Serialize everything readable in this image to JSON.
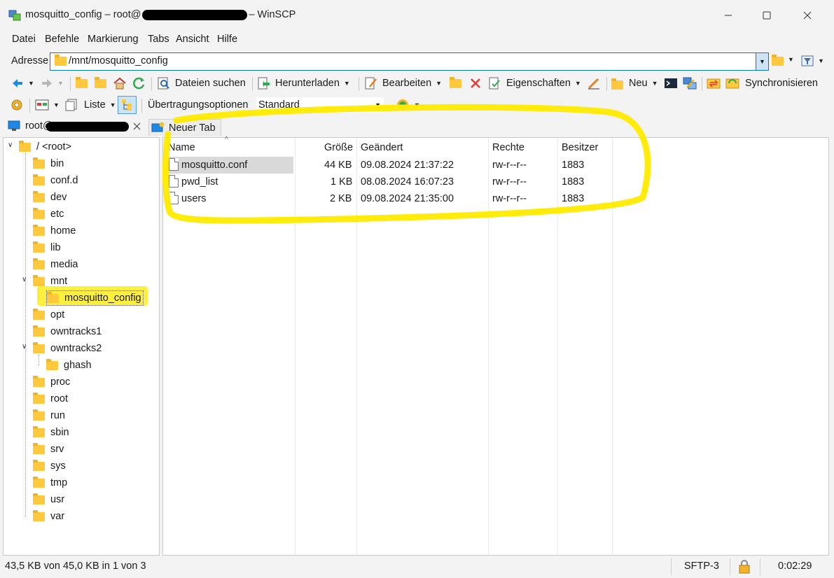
{
  "window": {
    "title": "mosquitto_config – root@",
    "title_suffix": "– WinSCP",
    "buttons": [
      "minimize",
      "maximize",
      "close"
    ]
  },
  "menu": [
    "Datei",
    "Befehle",
    "Markierung",
    "Tabs",
    "Ansicht",
    "Hilfe"
  ],
  "address": {
    "label": "Adresse",
    "value": "/mnt/mosquitto_config"
  },
  "toolbar1": {
    "find_files": "Dateien suchen",
    "download": "Herunterladen",
    "edit": "Bearbeiten",
    "properties": "Eigenschaften",
    "new": "Neu",
    "synchronize": "Synchronisieren"
  },
  "toolbar2": {
    "view": "Liste",
    "transfer_options_label": "Übertragungsoptionen",
    "transfer_options_value": "Standard"
  },
  "tabs": {
    "session": "root@",
    "new_tab": "Neuer Tab"
  },
  "tree": {
    "root": "/ <root>",
    "items": [
      "bin",
      "conf.d",
      "dev",
      "etc",
      "home",
      "lib",
      "media",
      "mnt",
      "mosquitto_config",
      "opt",
      "owntracks1",
      "owntracks2",
      "ghash",
      "proc",
      "root",
      "run",
      "sbin",
      "srv",
      "sys",
      "tmp",
      "usr",
      "var"
    ]
  },
  "files": {
    "columns": [
      "Name",
      "Größe",
      "Geändert",
      "Rechte",
      "Besitzer"
    ],
    "rows": [
      {
        "name": "mosquitto.conf",
        "size": "44 KB",
        "modified": "09.08.2024 21:37:22",
        "rights": "rw-r--r--",
        "owner": "1883"
      },
      {
        "name": "pwd_list",
        "size": "1 KB",
        "modified": "08.08.2024 16:07:23",
        "rights": "rw-r--r--",
        "owner": "1883"
      },
      {
        "name": "users",
        "size": "2 KB",
        "modified": "09.08.2024 21:35:00",
        "rights": "rw-r--r--",
        "owner": "1883"
      }
    ]
  },
  "status": {
    "selection": "43,5 KB von 45,0 KB in 1 von 3",
    "protocol": "SFTP-3",
    "elapsed": "0:02:29"
  },
  "colors": {
    "highlight": "#ffeb00",
    "accent": "#0078d4",
    "folder": "#ffc83d"
  }
}
